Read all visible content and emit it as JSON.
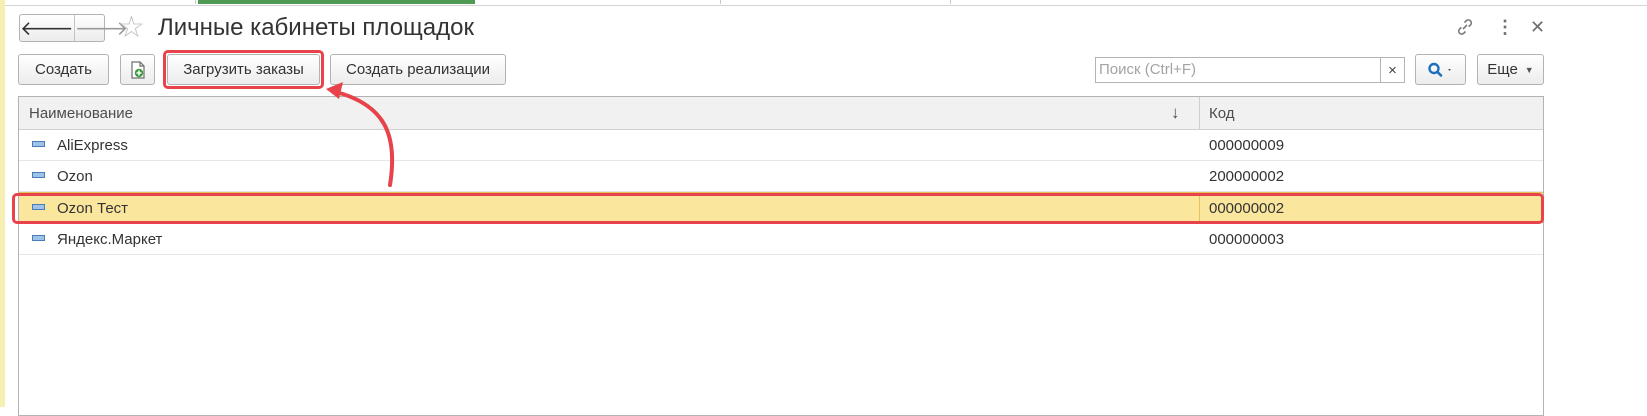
{
  "header": {
    "title": "Личные кабинеты площадок",
    "back_icon": "arrow-left-icon",
    "forward_icon": "arrow-right-icon",
    "favorite_icon": "star-icon",
    "link_icon": "link-icon",
    "more_icon": "more-vertical-icon",
    "close_icon": "close-icon"
  },
  "toolbar": {
    "create_label": "Создать",
    "copy_icon": "add-document-icon",
    "load_orders_label": "Загрузить заказы",
    "create_sales_label": "Создать реализации",
    "search_placeholder": "Поиск (Ctrl+F)",
    "search_clear": "×",
    "search_icon": "magnifier-icon",
    "more_label": "Еще"
  },
  "table": {
    "columns": [
      "Наименование",
      "Код"
    ],
    "sort_indicator": "↓",
    "rows": [
      {
        "name": "AliExpress",
        "code": "000000009"
      },
      {
        "name": "Ozon",
        "code": "200000002"
      },
      {
        "name": "Ozon Тест",
        "code": "000000002"
      },
      {
        "name": "Яндекс.Маркет",
        "code": "000000003"
      }
    ],
    "selected_row": 2
  },
  "colors": {
    "accent_green": "#4e9a52",
    "selection": "#fbe69e",
    "annotation_red": "#e8424b",
    "search_blue": "#1f6fbf"
  }
}
